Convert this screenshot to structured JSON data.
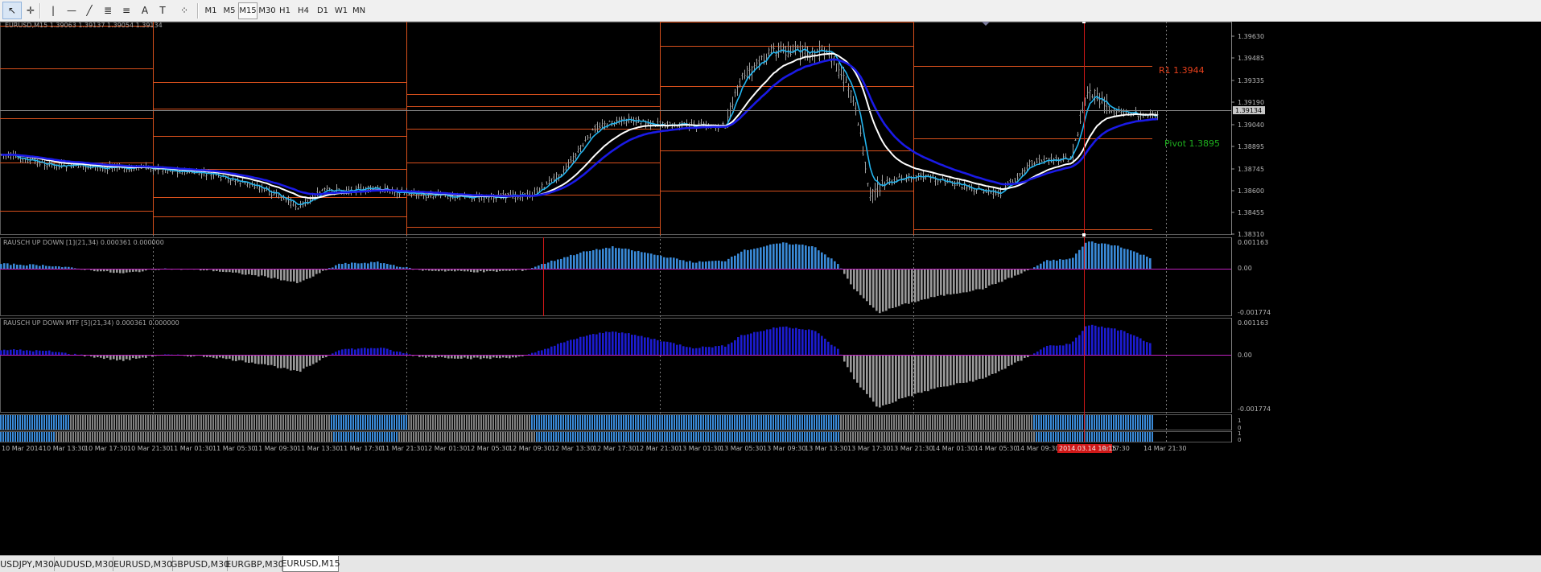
{
  "toolbar": {
    "tools": [
      {
        "name": "cursor-icon",
        "glyph": "↖"
      },
      {
        "name": "crosshair-icon",
        "glyph": "✛"
      },
      {
        "name": "vertical-line-icon",
        "glyph": "|"
      },
      {
        "name": "horizontal-line-icon",
        "glyph": "—"
      },
      {
        "name": "trendline-icon",
        "glyph": "╱"
      },
      {
        "name": "fibonacci-icon",
        "glyph": "≣"
      },
      {
        "name": "fibonacci-fan-icon",
        "glyph": "≡"
      },
      {
        "name": "text-icon",
        "glyph": "A"
      },
      {
        "name": "text-label-icon",
        "glyph": "T"
      },
      {
        "name": "shapes-dropdown-icon",
        "glyph": "⁘"
      }
    ],
    "timeframes": [
      "M1",
      "M5",
      "M15",
      "M30",
      "H1",
      "H4",
      "D1",
      "W1",
      "MN"
    ],
    "active_timeframe": "M15"
  },
  "main": {
    "header": "EURUSD,M15  1.39063 1.39137 1.39054 1.39134",
    "price_ticks": [
      "1.39630",
      "1.39485",
      "1.39335",
      "1.39190",
      "1.39040",
      "1.38895",
      "1.38745",
      "1.38600",
      "1.38455",
      "1.38310"
    ],
    "current_price": "1.39134",
    "r1_label": "R1 1.3944",
    "pivot_label": "Pivot 1.3895"
  },
  "indicator1": {
    "header": "RAUSCH UP DOWN [1](21,34) 0.000361 0.000000",
    "ticks": [
      "0.001163",
      "0.00",
      "-0.001774"
    ]
  },
  "indicator2": {
    "header": "RAUSCH UP DOWN MTF [5](21,34) 0.000361 0.000000",
    "ticks": [
      "0.001163",
      "0.00",
      "-0.001774"
    ]
  },
  "strips": {
    "ticks": [
      "1",
      "0",
      "1",
      "0"
    ]
  },
  "time_axis": {
    "labels": [
      "10 Mar 2014",
      "10 Mar 13:30",
      "10 Mar 17:30",
      "10 Mar 21:30",
      "11 Mar 01:30",
      "11 Mar 05:30",
      "11 Mar 09:30",
      "11 Mar 13:30",
      "11 Mar 17:30",
      "11 Mar 21:30",
      "12 Mar 01:30",
      "12 Mar 05:30",
      "12 Mar 09:30",
      "12 Mar 13:30",
      "12 Mar 17:30",
      "12 Mar 21:30",
      "13 Mar 01:30",
      "13 Mar 05:30",
      "13 Mar 09:30",
      "13 Mar 13:30",
      "13 Mar 17:30",
      "13 Mar 21:30",
      "14 Mar 01:30",
      "14 Mar 05:30",
      "14 Mar 09:30",
      "2014.03.14 10:15",
      "ar 17:30",
      "14 Mar 21:30"
    ]
  },
  "tabs": [
    {
      "label": "USDJPY,M30",
      "active": false
    },
    {
      "label": "AUDUSD,M30",
      "active": false
    },
    {
      "label": "EURUSD,M30",
      "active": false
    },
    {
      "label": "GBPUSD,M30",
      "active": false
    },
    {
      "label": "EURGBP,M30",
      "active": false
    },
    {
      "label": "EURUSD,M15",
      "active": true
    }
  ],
  "colors": {
    "background": "#000000",
    "candles": "#a0a0a0",
    "ema_fast": "#22b4ee",
    "ema_mid": "#ffffff",
    "ema_slow": "#1a1ae6",
    "pivot_lines": "#d8501c",
    "r1_text": "#e8401c",
    "pivot_text": "#1eae1e",
    "hist_up": "#3a8ad8",
    "hist_down": "#9a9a9a",
    "mtf_up": "#1c1cd0",
    "zero_line": "#c020c0",
    "crosshair": "#d01818"
  }
}
